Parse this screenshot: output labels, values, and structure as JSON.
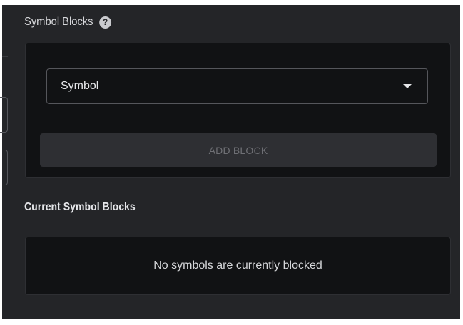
{
  "symbol_blocks": {
    "title": "Symbol Blocks",
    "help_icon_glyph": "?",
    "select_value": "Symbol",
    "add_button_label": "ADD BLOCK"
  },
  "current_blocks": {
    "title": "Current Symbol Blocks",
    "empty_message": "No symbols are currently blocked"
  },
  "icons": {
    "help": "question-circle-icon",
    "dropdown": "caret-down-icon"
  },
  "colors": {
    "panel_bg": "#242528",
    "card_bg": "#111214",
    "button_bg": "#2e2f33",
    "button_text": "#6f7075",
    "text": "#e6e7ea"
  }
}
